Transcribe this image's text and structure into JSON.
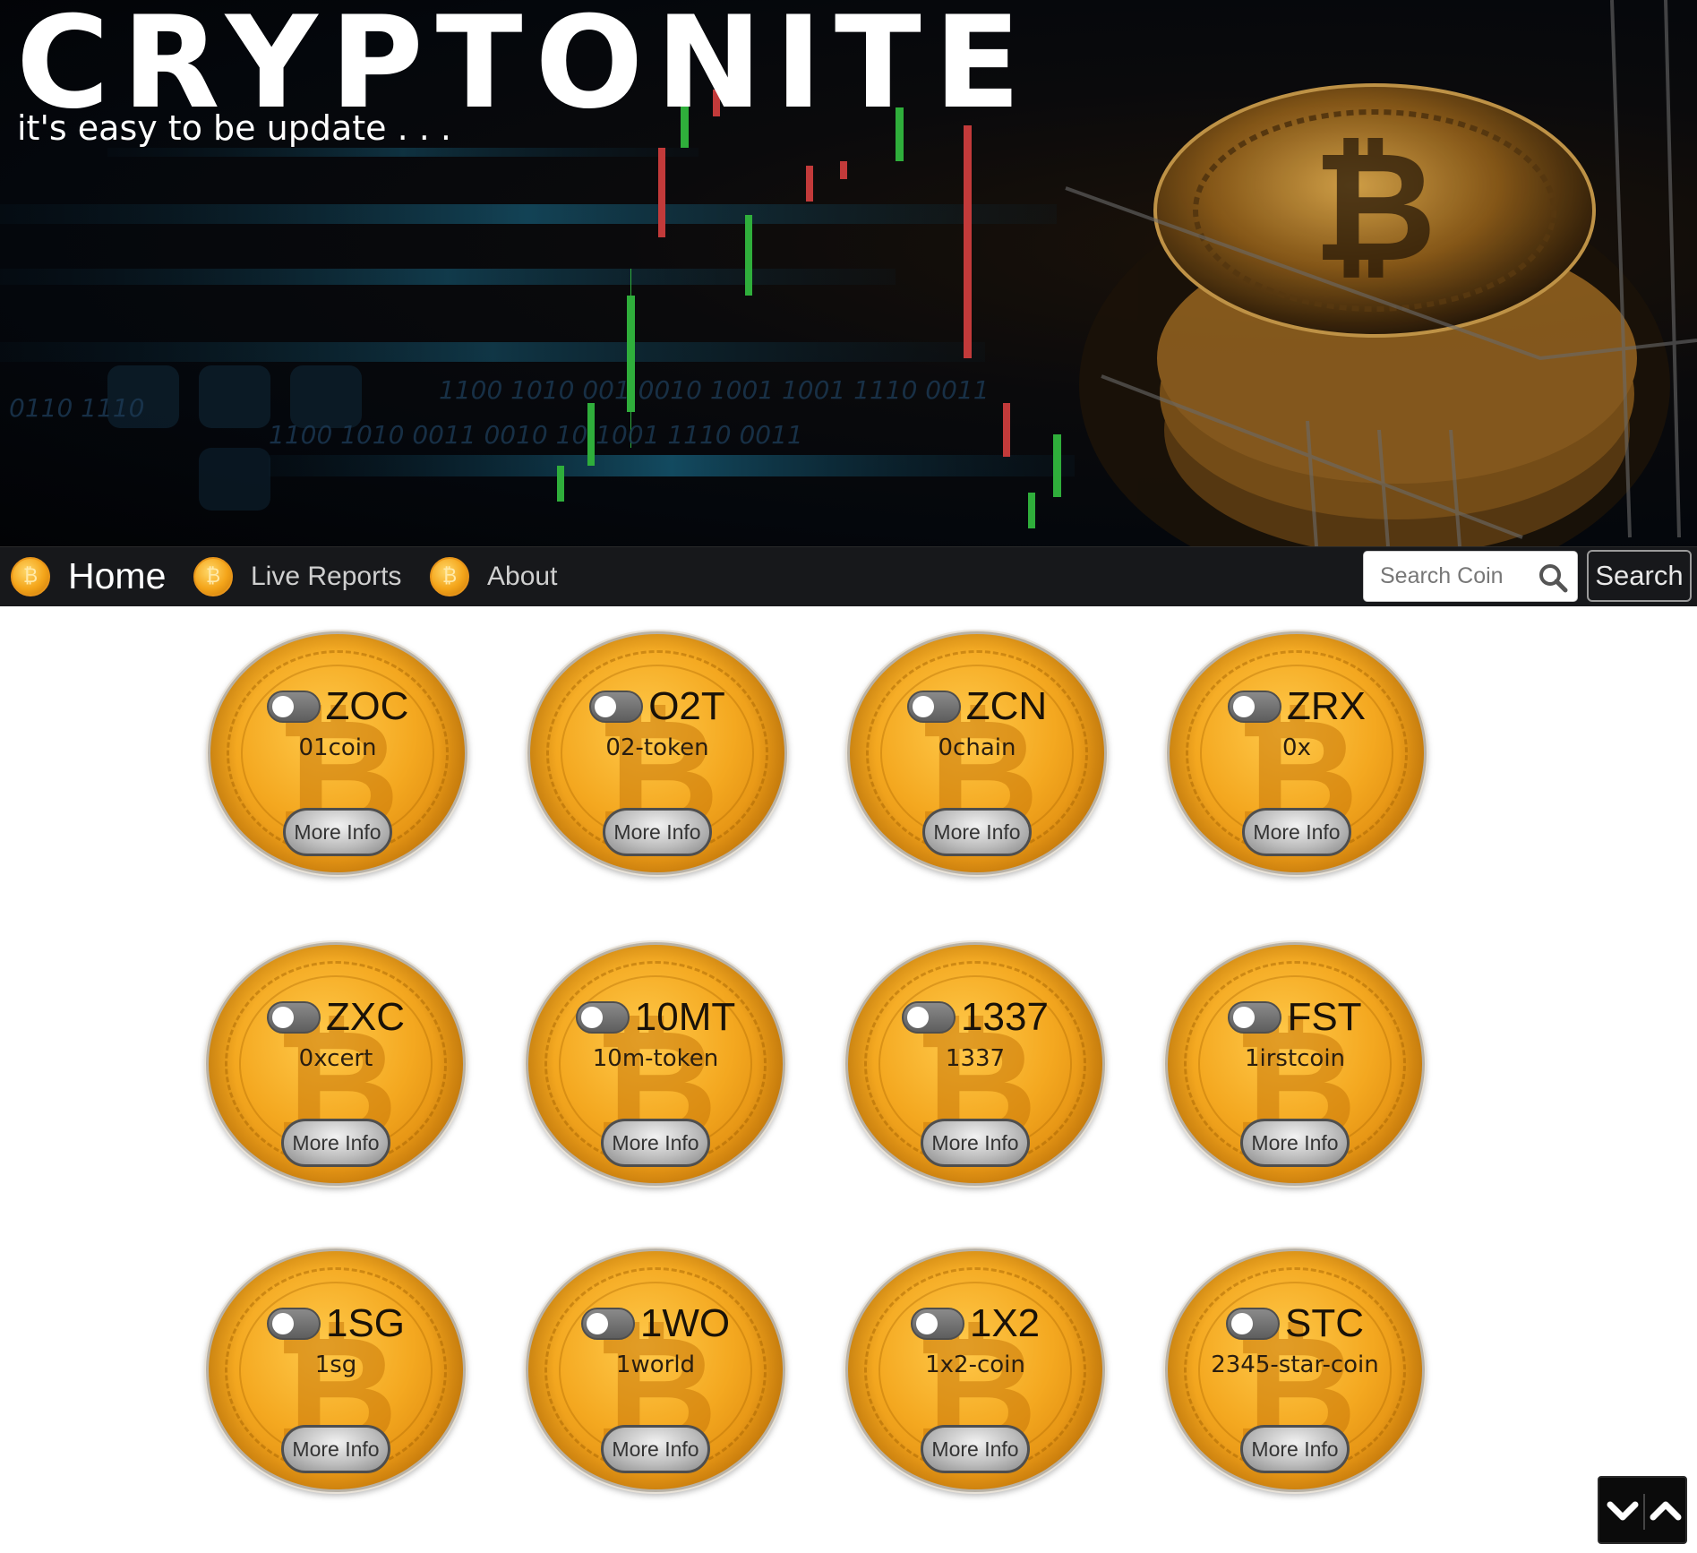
{
  "header": {
    "site_title": "CRYPTONITE",
    "tagline": "it's easy to be update . . ."
  },
  "nav": {
    "items": [
      {
        "label": "Home",
        "icon": "bitcoin-icon",
        "active": true
      },
      {
        "label": "Live Reports",
        "icon": "bitcoin-icon",
        "active": false
      },
      {
        "label": "About",
        "icon": "bitcoin-icon",
        "active": false
      }
    ],
    "search": {
      "placeholder": "Search Coin",
      "value": "",
      "icon": "search-icon",
      "button_label": "Search"
    }
  },
  "coins": [
    {
      "symbol": "ZOC",
      "name": "01coin",
      "button": "More Info",
      "toggle_on": false
    },
    {
      "symbol": "O2T",
      "name": "02-token",
      "button": "More Info",
      "toggle_on": false
    },
    {
      "symbol": "ZCN",
      "name": "0chain",
      "button": "More Info",
      "toggle_on": false
    },
    {
      "symbol": "ZRX",
      "name": "0x",
      "button": "More Info",
      "toggle_on": false
    },
    {
      "symbol": "ZXC",
      "name": "0xcert",
      "button": "More Info",
      "toggle_on": false
    },
    {
      "symbol": "10MT",
      "name": "10m-token",
      "button": "More Info",
      "toggle_on": false
    },
    {
      "symbol": "1337",
      "name": "1337",
      "button": "More Info",
      "toggle_on": false
    },
    {
      "symbol": "FST",
      "name": "1irstcoin",
      "button": "More Info",
      "toggle_on": false
    },
    {
      "symbol": "1SG",
      "name": "1sg",
      "button": "More Info",
      "toggle_on": false
    },
    {
      "symbol": "1WO",
      "name": "1world",
      "button": "More Info",
      "toggle_on": false
    },
    {
      "symbol": "1X2",
      "name": "1x2-coin",
      "button": "More Info",
      "toggle_on": false
    },
    {
      "symbol": "STC",
      "name": "2345-star-coin",
      "button": "More Info",
      "toggle_on": false
    }
  ],
  "scroll_widget": {
    "down_icon": "chevron-down-icon",
    "up_icon": "chevron-up-icon"
  },
  "colors": {
    "navbar": "#17181b",
    "coin_gold": "#f4a820",
    "nav_coin": "#f4a51a",
    "page_bg": "#ffffff"
  }
}
